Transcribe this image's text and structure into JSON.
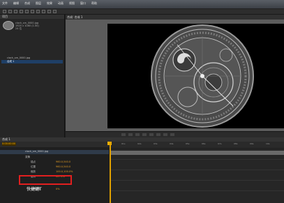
{
  "menubar": {
    "items": [
      "文件",
      "编辑",
      "合成",
      "图层",
      "效果",
      "动画",
      "视图",
      "窗口",
      "帮助"
    ]
  },
  "project": {
    "tab": "项目",
    "thumb_info": [
      "clock_sm_0000.jpg",
      "1920 x 1080 (1.00)",
      "24 位"
    ],
    "items": [
      "clock_sm_0000.jpg",
      "合成 1"
    ]
  },
  "comp": {
    "tab": "合成: 合成 1",
    "timecode": "0:00:00:00",
    "ruler_labels": [
      "01s",
      "02s",
      "03s",
      "04s",
      "05s",
      "06s",
      "07s",
      "08s",
      "09s",
      "10s"
    ]
  },
  "timeline": {
    "tab": "合成 1",
    "layer_name": "clock_sm_0000.jpg",
    "transform_label": "变换",
    "properties": [
      {
        "name": "锚点",
        "value": "960.0,540.0"
      },
      {
        "name": "位置",
        "value": "960.0,540.0"
      },
      {
        "name": "缩放",
        "value": "100.0,100.0%"
      },
      {
        "name": "旋转",
        "value": "0x+0.0°"
      },
      {
        "name": "不透明度",
        "value": "0%"
      }
    ]
  },
  "annotation": {
    "text": "快捷键T",
    "color": "#e21f1f"
  }
}
